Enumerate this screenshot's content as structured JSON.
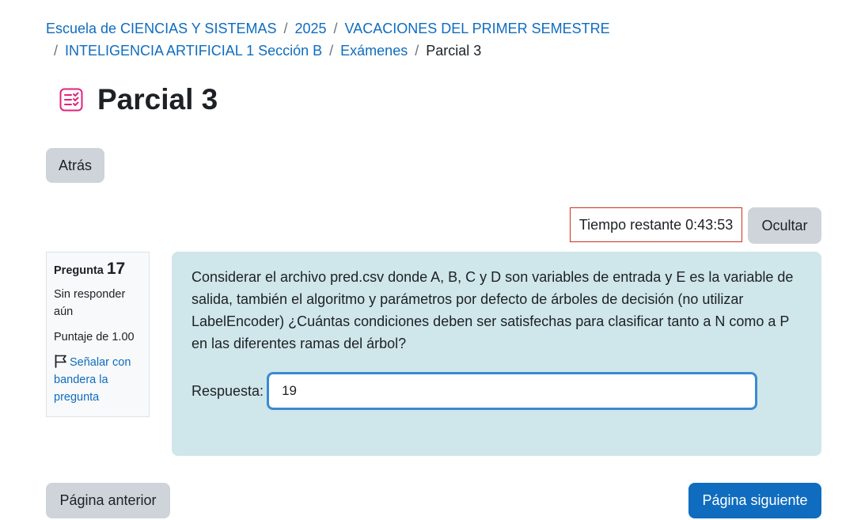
{
  "breadcrumb": {
    "items": [
      "Escuela de CIENCIAS Y SISTEMAS",
      "2025",
      "VACACIONES DEL PRIMER SEMESTRE",
      "INTELIGENCIA ARTIFICIAL 1 Sección B",
      "Exámenes"
    ],
    "current": "Parcial 3",
    "separator": "/"
  },
  "page": {
    "title": "Parcial 3",
    "icon": "quiz-icon"
  },
  "buttons": {
    "back": "Atrás",
    "hide": "Ocultar",
    "previous_page": "Página anterior",
    "next_page": "Página siguiente"
  },
  "timer": {
    "text": "Tiempo restante 0:43:53"
  },
  "question_info": {
    "label": "Pregunta",
    "number": "17",
    "state": "Sin responder aún",
    "grade": "Puntaje de 1.00",
    "flag_text": "Señalar con bandera la pregunta"
  },
  "question": {
    "text": "Considerar el archivo pred.csv donde A, B, C y D son variables de entrada y E es la variable de salida, también el algoritmo y parámetros por defecto de árboles de decisión (no utilizar LabelEncoder) ¿Cuántas condiciones deben ser satisfechas para clasificar tanto a N como a P en las diferentes ramas del árbol?",
    "answer_label": "Respuesta:",
    "answer_value": "19"
  },
  "colors": {
    "link": "#0f6cbf",
    "primary_button": "#0f6cbf",
    "secondary_button": "#ced4da",
    "question_background": "#cfe6ea",
    "timer_border": "#ca3120",
    "quiz_icon": "#e2217d"
  }
}
